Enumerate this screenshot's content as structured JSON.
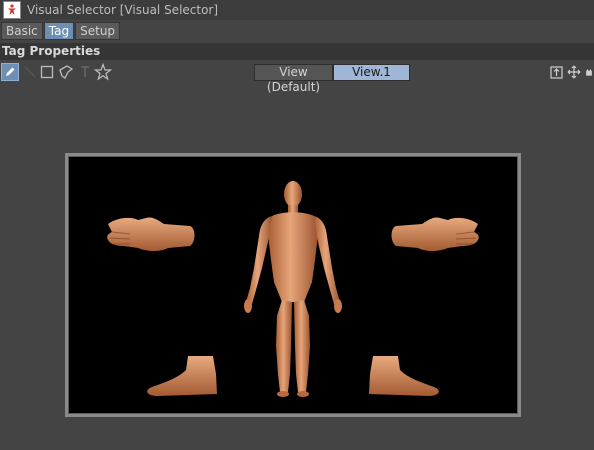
{
  "window": {
    "title": "Visual Selector [Visual Selector]",
    "app_icon": "human-figure-icon"
  },
  "tabs": [
    {
      "label": "Basic",
      "active": false
    },
    {
      "label": "Tag",
      "active": true
    },
    {
      "label": "Setup",
      "active": false
    }
  ],
  "section": {
    "title": "Tag Properties"
  },
  "toolbar": {
    "tools": [
      {
        "icon": "pencil-icon",
        "selected": true
      },
      {
        "icon": "line-icon",
        "selected": false
      },
      {
        "icon": "square-icon",
        "selected": false
      },
      {
        "icon": "polygon-icon",
        "selected": false
      },
      {
        "icon": "text-icon",
        "selected": false
      },
      {
        "icon": "star-icon",
        "selected": false
      }
    ],
    "views": [
      {
        "label": "View (Default)",
        "active": false
      },
      {
        "label": "View.1",
        "active": true
      }
    ],
    "right_icons": [
      "frame-icon",
      "move-icon",
      "pan-icon"
    ]
  },
  "canvas": {
    "background": "#000000",
    "skin_color": "#d28a5c",
    "parts": [
      "left-hand",
      "right-hand",
      "body",
      "left-foot",
      "right-foot"
    ]
  }
}
